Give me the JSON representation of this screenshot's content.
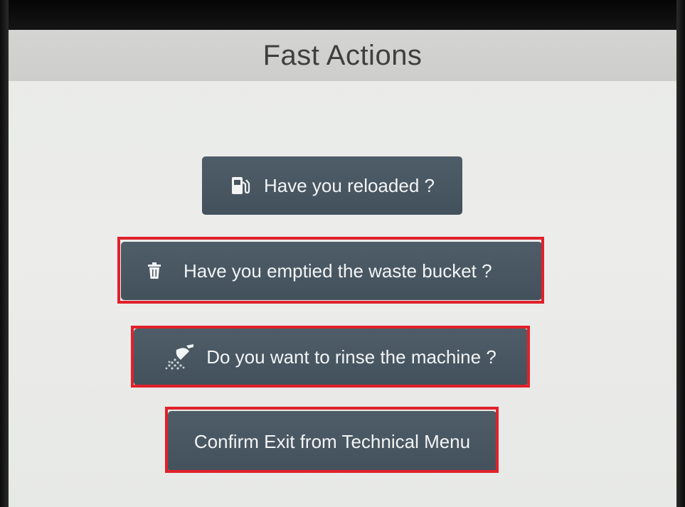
{
  "header": {
    "title": "Fast Actions"
  },
  "actions": [
    {
      "label": "Have you reloaded ?",
      "icon": "fuel-pump-icon"
    },
    {
      "label": "Have you emptied the waste bucket ?",
      "icon": "trash-icon"
    },
    {
      "label": "Do you want to rinse the machine ?",
      "icon": "shower-icon"
    },
    {
      "label": "Confirm Exit from Technical Menu"
    }
  ],
  "colors": {
    "button": "#47555f",
    "highlight": "#e0212b",
    "header": "#d1d2cf",
    "screen": "#eaebe8"
  }
}
